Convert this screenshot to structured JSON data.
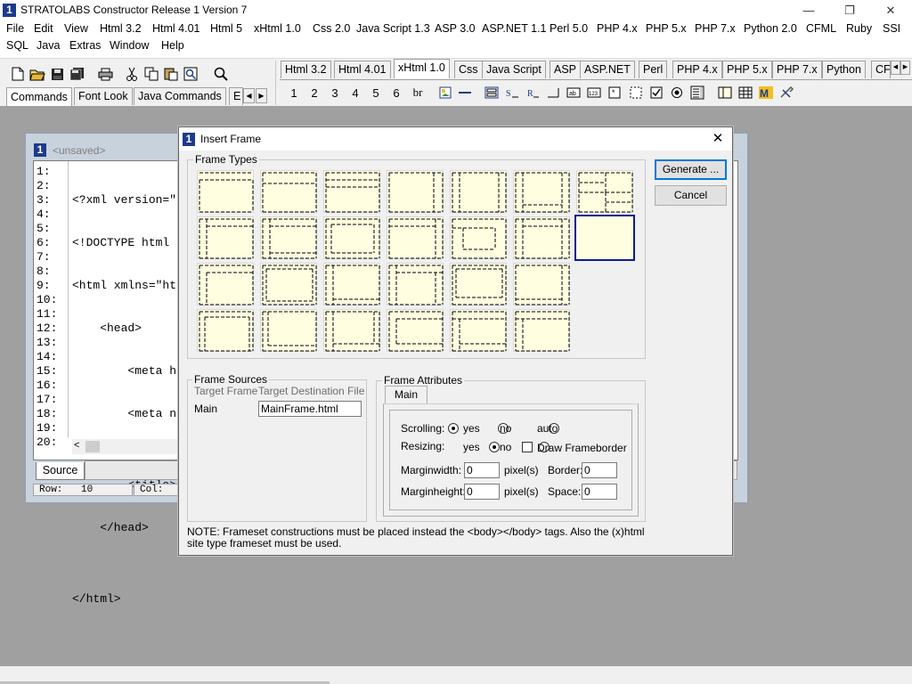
{
  "app": {
    "title": "STRATOLABS Constructor Release 1 Version 7",
    "icon_text": "1",
    "minimize_glyph": "—",
    "restore_glyph": "❐",
    "close_glyph": "✕"
  },
  "menubar": {
    "row1": [
      "File",
      "Edit",
      "View",
      "Html 3.2",
      "Html 4.01",
      "Html 5",
      "xHtml 1.0",
      "Css 2.0",
      "Java Script 1.3",
      "ASP 3.0",
      "ASP.NET 1.1",
      "Perl 5.0",
      "PHP 4.x",
      "PHP 5.x",
      "PHP 7.x",
      "Python 2.0",
      "CFML",
      "Ruby",
      "SSI"
    ],
    "row2": [
      "SQL",
      "Java",
      "Extras",
      "Window",
      "Help"
    ]
  },
  "toolbar": {
    "left_tabs": [
      "Commands",
      "Font Look",
      "Java Commands",
      "E"
    ],
    "lang_tabs": [
      "Html 3.2",
      "Html 4.01",
      "xHtml 1.0",
      "Css",
      "Java Script",
      "ASP",
      "ASP.NET",
      "Perl",
      "PHP 4.x",
      "PHP 5.x",
      "PHP 7.x",
      "Python",
      "CF"
    ],
    "active_lang_tab": "xHtml 1.0",
    "heading_buttons": [
      "1",
      "2",
      "3",
      "4",
      "5",
      "6",
      "br"
    ]
  },
  "editor": {
    "doc_icon": "1",
    "title": "<unsaved>",
    "line_numbers": [
      "1:",
      "2:",
      "3:",
      "4:",
      "5:",
      "6:",
      "7:",
      "8:",
      "9:",
      "10:",
      "11:",
      "12:",
      "13:",
      "14:",
      "15:",
      "16:",
      "17:",
      "18:",
      "19:",
      "20:"
    ],
    "code_lines": [
      "<?xml version=\"",
      "<!DOCTYPE html",
      "<html xmlns=\"ht",
      "    <head>",
      "        <meta h",
      "        <meta n",
      "",
      "        <title>",
      "    </head>",
      "",
      "</html>",
      "",
      "",
      "",
      "",
      "",
      "",
      "",
      "",
      ""
    ],
    "source_tab": "Source",
    "row_label": "Row:",
    "row_value": "10",
    "col_label": "Col:"
  },
  "dialog": {
    "icon_text": "1",
    "title": "Insert Frame",
    "close_glyph": "✕",
    "frame_types_label": "Frame Types",
    "generate_button": "Generate ...",
    "cancel_button": "Cancel",
    "frame_sources": {
      "label": "Frame Sources",
      "col_target": "Target Frame",
      "col_destination": "Target Destination File",
      "row_target": "Main",
      "row_file": "MainFrame.html"
    },
    "frame_attributes": {
      "label": "Frame Attributes",
      "tab": "Main",
      "scrolling_label": "Scrolling:",
      "scrolling_options": [
        "yes",
        "no",
        "auto"
      ],
      "scrolling_selected": "yes",
      "resizing_label": "Resizing:",
      "resizing_options": [
        "yes",
        "no"
      ],
      "resizing_selected": "yes",
      "draw_frameborder_label": "Draw Frameborder",
      "draw_frameborder_checked": false,
      "marginwidth_label": "Marginwidth:",
      "marginwidth_value": "0",
      "marginheight_label": "Marginheight:",
      "marginheight_value": "0",
      "pixels_label": "pixel(s)",
      "border_label": "Border:",
      "border_value": "0",
      "space_label": "Space:",
      "space_value": "0"
    },
    "note": "NOTE: Frameset constructions must be placed instead the <body></body> tags. Also the (x)html site type frameset must be used."
  },
  "colors": {
    "accent": "#0078d7",
    "selected_frame_border": "#0a1e8c",
    "frame_fill": "#fffee0",
    "app_icon_bg": "#1d3b8c"
  }
}
